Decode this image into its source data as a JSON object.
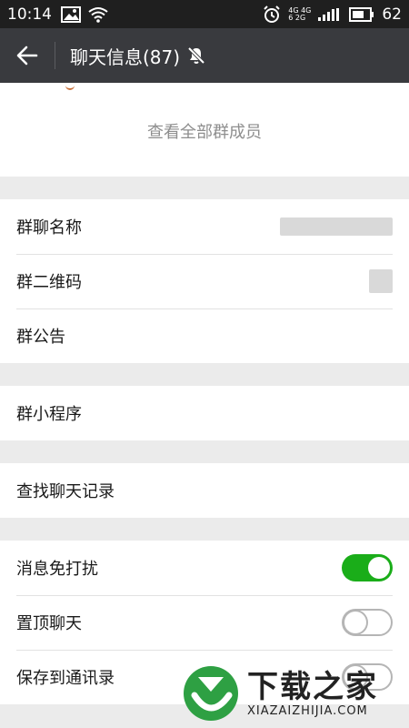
{
  "status_bar": {
    "time": "10:14",
    "network_top": "4G 4G",
    "network_bottom": "6 2G",
    "battery": "62",
    "icons": [
      "image-icon",
      "wifi-icon",
      "alarm-icon",
      "signal-icon",
      "battery-icon"
    ]
  },
  "header": {
    "title": "聊天信息(87)",
    "back_icon": "arrow-left-icon",
    "mute_icon": "bell-off-icon"
  },
  "members": {
    "view_all_label": "查看全部群成员"
  },
  "settings": {
    "group_name_label": "群聊名称",
    "qr_code_label": "群二维码",
    "announcement_label": "群公告",
    "mini_program_label": "群小程序",
    "search_history_label": "查找聊天记录",
    "mute_label": "消息免打扰",
    "pin_label": "置顶聊天",
    "save_contacts_label": "保存到通讯录"
  },
  "toggles": {
    "mute": true,
    "pin": false,
    "save_contacts": false
  },
  "colors": {
    "toggle_on": "#1aad19",
    "title_bar": "#393a3e",
    "status_bar": "#1f1f1f",
    "page_bg": "#ebebeb"
  },
  "watermark": {
    "cn": "下载之家",
    "en": "XIAZAIZHIJIA.COM"
  }
}
